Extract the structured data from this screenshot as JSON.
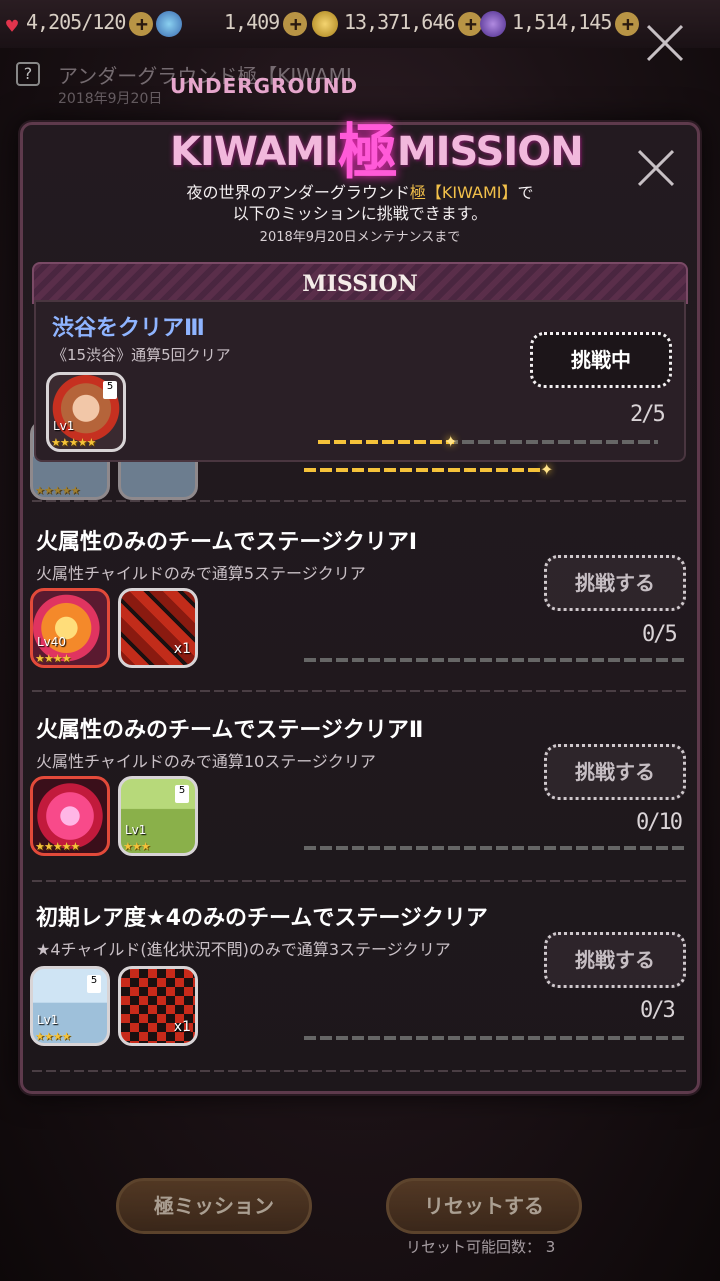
{
  "resources": {
    "stamina": "4,205/120",
    "gems": "1,409",
    "coins": "13,371,646",
    "other": "1,514,145"
  },
  "background": {
    "title": "アンダーグラウンド極【KIWAMI",
    "date": "2018年9月20日"
  },
  "logo": {
    "small": "UNDERGROUND",
    "left": "KIWAMI",
    "kanji": "極",
    "right": "MISSION"
  },
  "intro": {
    "line1_pre": "夜の世界のアンダーグラウンド",
    "line1_hl": "極【KIWAMI】",
    "line1_post": "で",
    "line2": "以下のミッションに挑戦できます。",
    "sub": "2018年9月20日メンテナンスまで"
  },
  "mission_header": "MISSION",
  "missions": [
    {
      "title": "渋谷をクリアⅢ",
      "desc": "《15渋谷》通算5回クリア",
      "button": "挑戦中",
      "count": "2/5",
      "progress": 0.4,
      "reward": {
        "lv": "Lv1",
        "stars": "★★★★★"
      }
    },
    {
      "title": "火属性のみのチームでステージクリアⅠ",
      "desc": "火属性チャイルドのみで通算5ステージクリア",
      "button": "挑戦する",
      "count": "0/5",
      "progress": 0,
      "reward1": {
        "lv": "Lv40",
        "stars": "★★★★"
      },
      "reward2": {
        "qty": "x1"
      }
    },
    {
      "title": "火属性のみのチームでステージクリアⅡ",
      "desc": "火属性チャイルドのみで通算10ステージクリア",
      "button": "挑戦する",
      "count": "0/10",
      "progress": 0,
      "reward1": {
        "stars": "★★★★★"
      },
      "reward2": {
        "lv": "Lv1",
        "stars": "★★★"
      }
    },
    {
      "title": "初期レア度★4のみのチームでステージクリア",
      "desc": "★4チャイルド(進化状況不問)のみで通算3ステージクリア",
      "button": "挑戦する",
      "count": "0/3",
      "progress": 0,
      "reward1": {
        "lv": "Lv1",
        "stars": "★★★★"
      },
      "reward2": {
        "qty": "x1"
      }
    }
  ],
  "partial_stars": "★★★★★",
  "bottom": {
    "kiwami_button": "極ミッション",
    "reset_button": "リセットする",
    "reset_label": "リセット可能回数：",
    "reset_count": "3"
  },
  "colors": {
    "accent": "#f2c04a",
    "active_title": "#8fb4ff",
    "modal_border": "#5e3a4c"
  }
}
